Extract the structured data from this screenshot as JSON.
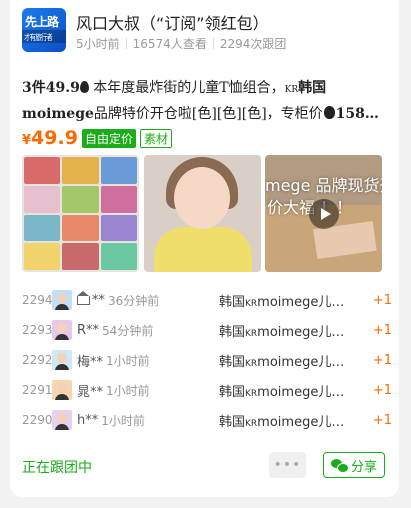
{
  "header": {
    "logo_line1": "先上路",
    "logo_line2": "才有旅行者",
    "title": "风口大叔（“订阅”领红包）",
    "time_ago": "5小时前",
    "views": "16574人查看",
    "group_count": "2294次跟团"
  },
  "post": {
    "desc_lead": "3件49.9",
    "desc_body": " 本年度最炸街的儿童T恤组合，",
    "desc_kr": "KR",
    "desc_brand": "韩国moimege",
    "desc_tail": "品牌特价开仓啦[色][色][色]，专柜价",
    "desc_price": "158…",
    "price_symbol": "¥",
    "price_value": "49.9",
    "tag_free": "自由定价",
    "tag_material": "素材",
    "video_text_line1": "mege 品牌现货开",
    "video_text_line2": "价大福 ！！"
  },
  "orders": [
    {
      "num": "2294",
      "name": "**",
      "time": "36分钟前",
      "item_prefix": "韩国",
      "item_kr": "KR",
      "item_suffix": "moimege儿…",
      "qty": "+1",
      "crown": true
    },
    {
      "num": "2293",
      "name": "R**",
      "time": "54分钟前",
      "item_prefix": "韩国",
      "item_kr": "KR",
      "item_suffix": "moimege儿…",
      "qty": "+1",
      "crown": false
    },
    {
      "num": "2292",
      "name": "梅**",
      "time": "1小时前",
      "item_prefix": "韩国",
      "item_kr": "KR",
      "item_suffix": "moimege儿…",
      "qty": "+1",
      "crown": false
    },
    {
      "num": "2291",
      "name": "晁**",
      "time": "1小时前",
      "item_prefix": "韩国",
      "item_kr": "KR",
      "item_suffix": "moimege儿…",
      "qty": "+1",
      "crown": false
    },
    {
      "num": "2290",
      "name": "h**",
      "time": "1小时前",
      "item_prefix": "韩国",
      "item_kr": "KR",
      "item_suffix": "moimege儿…",
      "qty": "+1",
      "crown": false
    }
  ],
  "footer": {
    "status": "正在跟团中",
    "more_label": "•••",
    "share_label": "分享"
  },
  "colors": {
    "accent_green": "#1aad19",
    "price_orange": "#ff6a00"
  }
}
